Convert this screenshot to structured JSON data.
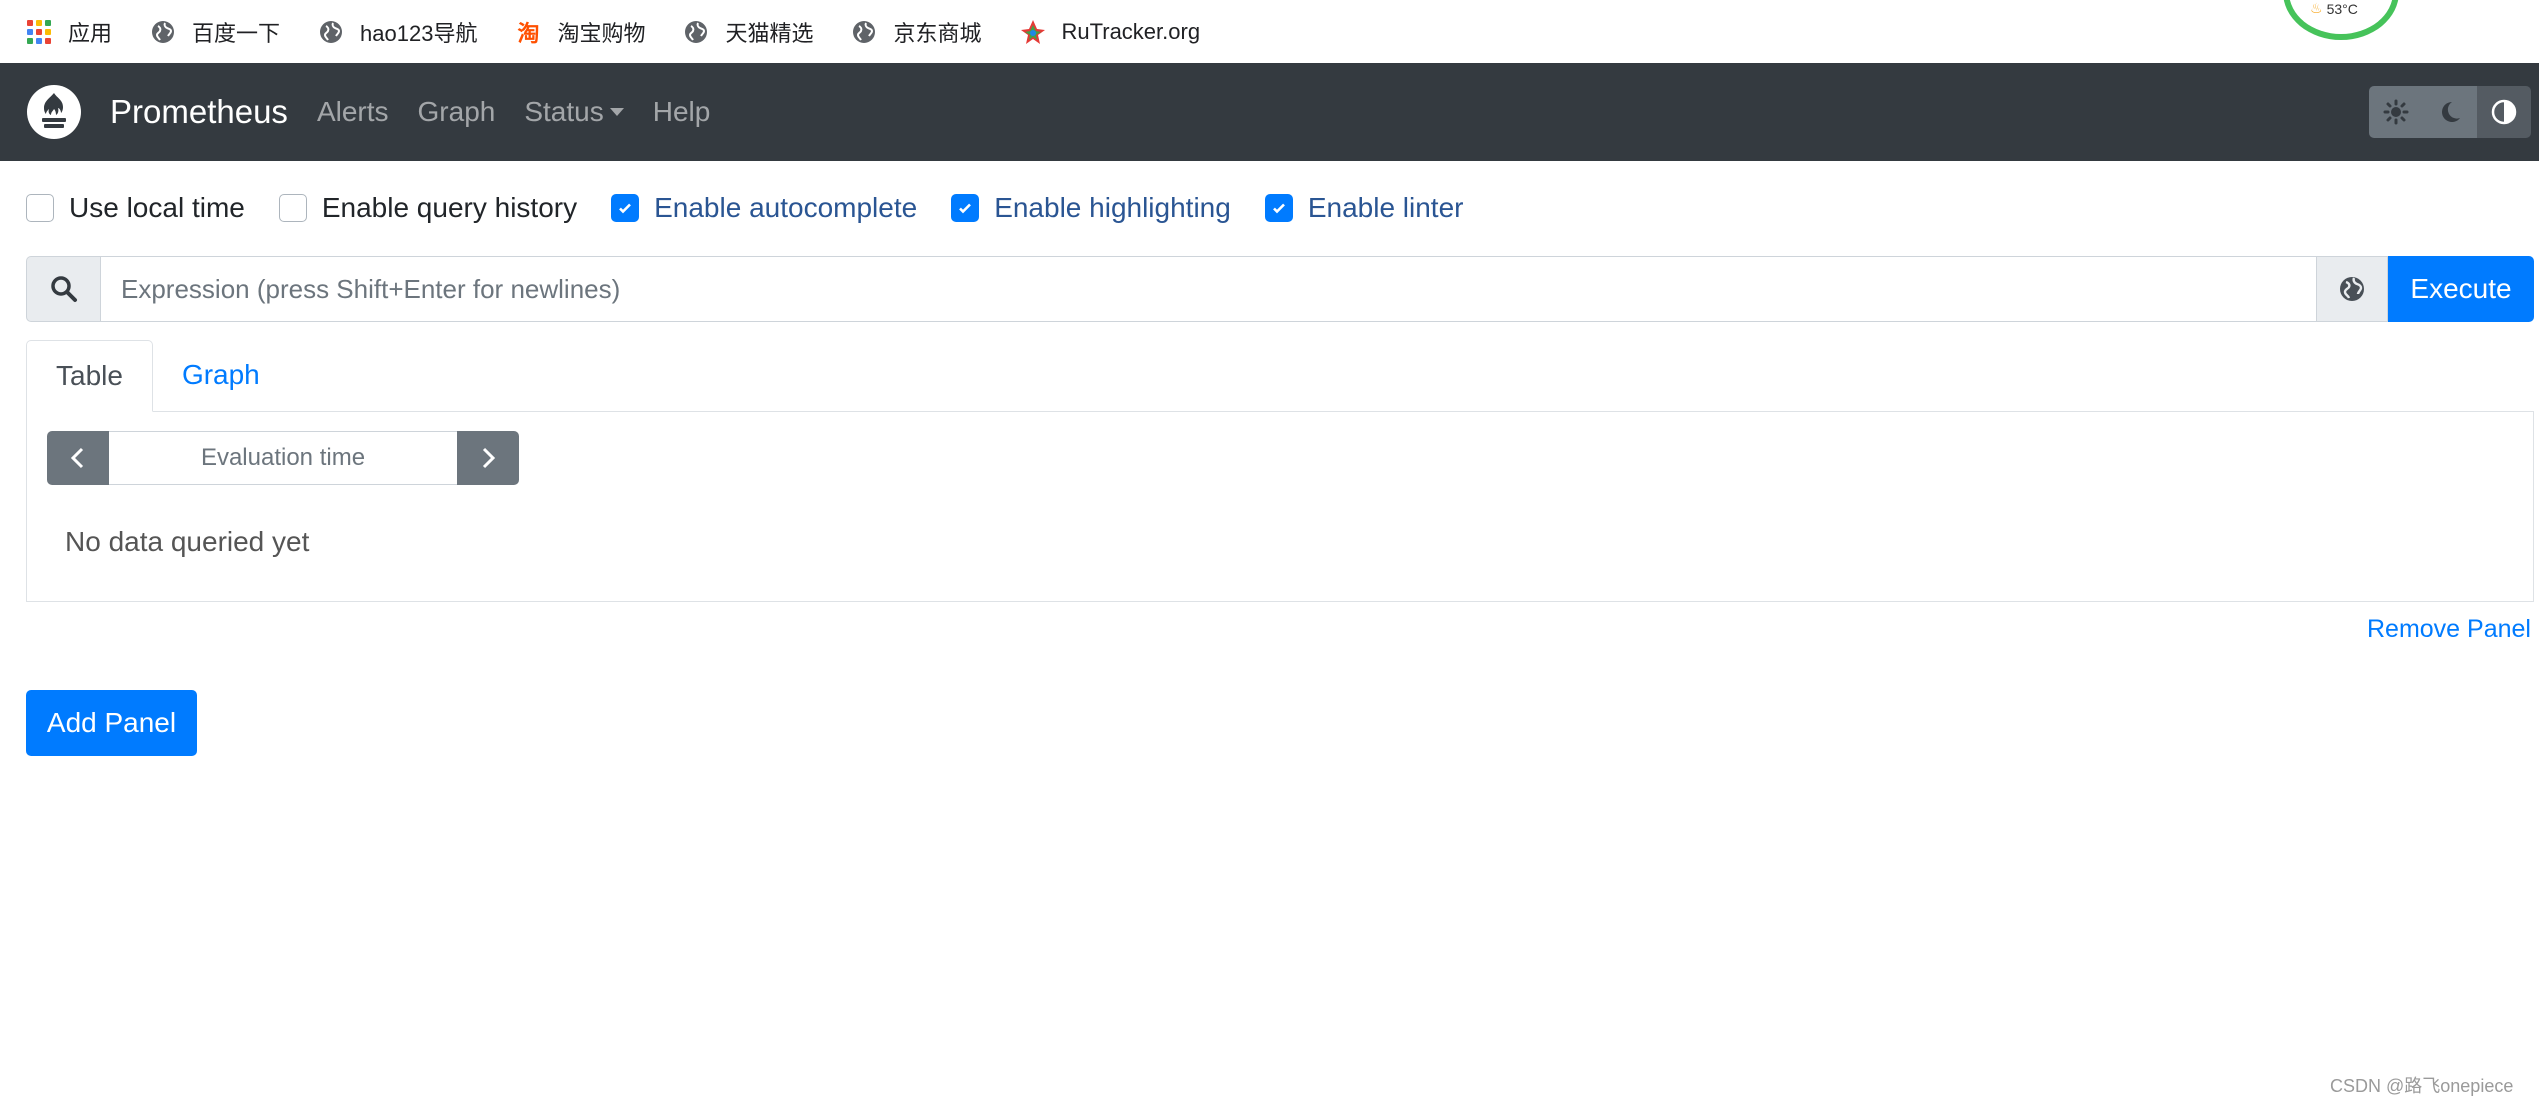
{
  "colors": {
    "navbar_bg": "#343a40",
    "primary": "#007bff",
    "checked_label": "#2a5593",
    "addon_bg": "#e9ecef",
    "secondary_btn": "#6c757d"
  },
  "bookmarks": [
    {
      "label": "应用",
      "icon": "apps-grid-icon"
    },
    {
      "label": "百度一下",
      "icon": "globe-icon"
    },
    {
      "label": "hao123导航",
      "icon": "globe-icon"
    },
    {
      "label": "淘宝购物",
      "icon": "taobao-icon",
      "icon_glyph": "淘"
    },
    {
      "label": "天猫精选",
      "icon": "globe-icon"
    },
    {
      "label": "京东商城",
      "icon": "globe-icon"
    },
    {
      "label": "RuTracker.org",
      "icon": "rutracker-icon"
    }
  ],
  "temperature_widget": {
    "text": "53°C",
    "icon": "flame-icon"
  },
  "navbar": {
    "brand": "Prometheus",
    "links": [
      "Alerts",
      "Graph",
      "Status",
      "Help"
    ],
    "status_has_dropdown": true,
    "theme_buttons": [
      "sun-icon",
      "moon-icon",
      "half-circle-icon"
    ],
    "active_theme": "half-circle-icon"
  },
  "options": [
    {
      "label": "Use local time",
      "checked": false
    },
    {
      "label": "Enable query history",
      "checked": false
    },
    {
      "label": "Enable autocomplete",
      "checked": true
    },
    {
      "label": "Enable highlighting",
      "checked": true
    },
    {
      "label": "Enable linter",
      "checked": true
    }
  ],
  "expression": {
    "value": "",
    "placeholder": "Expression (press Shift+Enter for newlines)",
    "execute_label": "Execute"
  },
  "panel": {
    "tabs": [
      "Table",
      "Graph"
    ],
    "active_tab": "Table",
    "eval_time_placeholder": "Evaluation time",
    "empty_message": "No data queried yet",
    "remove_label": "Remove Panel"
  },
  "add_panel_label": "Add Panel",
  "watermark": "CSDN @路飞onepiece"
}
